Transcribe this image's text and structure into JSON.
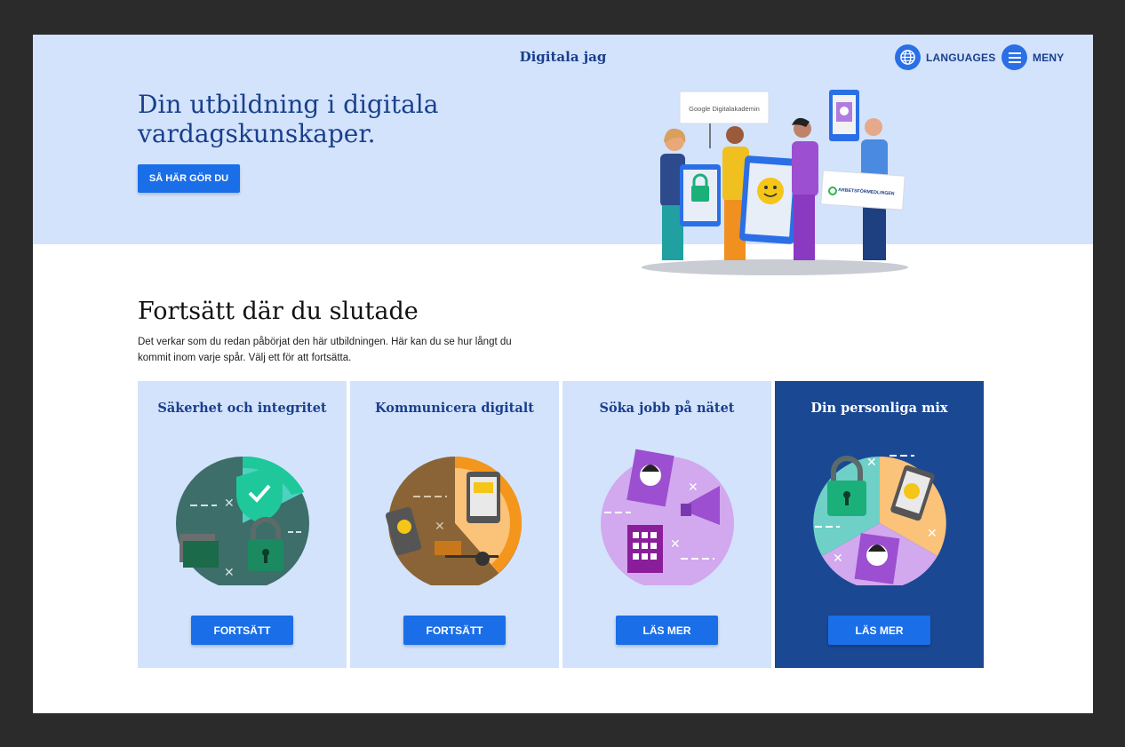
{
  "header": {
    "site_title": "Digitala jag",
    "languages_label": "LANGUAGES",
    "menu_label": "MENY"
  },
  "hero": {
    "heading": "Din utbildning i digitala vardagskunskaper.",
    "cta_label": "SÅ HÄR GÖR DU",
    "sign_google": "Google Digitalakademin",
    "sign_af": "ARBETSFÖRMEDLINGEN"
  },
  "continue_section": {
    "title": "Fortsätt där du slutade",
    "description": "Det verkar som du redan påbörjat den här utbildningen. Här kan du se hur långt du kommit inom varje spår. Välj ett för att fortsätta."
  },
  "cards": [
    {
      "title": "Säkerhet och integritet",
      "button_label": "FORTSÄTT",
      "icon": "security-lock-shield-icon"
    },
    {
      "title": "Kommunicera digitalt",
      "button_label": "FORTSÄTT",
      "icon": "communication-chat-icon"
    },
    {
      "title": "Söka jobb på nätet",
      "button_label": "LÄS MER",
      "icon": "job-search-megaphone-icon"
    },
    {
      "title": "Din personliga mix",
      "button_label": "LÄS MER",
      "icon": "personal-mix-pie-icon"
    }
  ],
  "colors": {
    "hero_bg": "#d3e3fc",
    "brand_blue": "#1a3f8c",
    "button_blue": "#1a6ee8",
    "dark_card": "#1b4893"
  }
}
